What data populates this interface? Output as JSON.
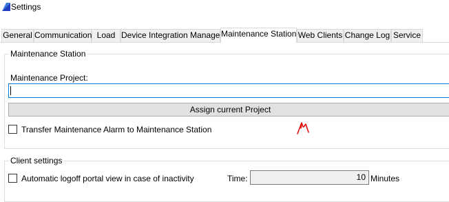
{
  "window": {
    "title": "Settings",
    "icon": "app-icon"
  },
  "tabs": [
    {
      "label": "General",
      "active": false
    },
    {
      "label": "Communication",
      "active": false
    },
    {
      "label": "Load",
      "active": false
    },
    {
      "label": "Device Integration Manager",
      "active": false
    },
    {
      "label": "Maintenance Station",
      "active": true
    },
    {
      "label": "Web Clients",
      "active": false
    },
    {
      "label": "Change Log",
      "active": false
    },
    {
      "label": "Service",
      "active": false
    }
  ],
  "maintenance": {
    "group_title": "Maintenance Station",
    "project_label": "Maintenance Project:",
    "project_value": "",
    "assign_button": "Assign current Project",
    "transfer_alarm_label": "Transfer Maintenance Alarm to Maintenance Station",
    "transfer_alarm_checked": false
  },
  "client": {
    "group_title": "Client settings",
    "auto_logoff_label": "Automatic logoff portal view in case of inactivity",
    "auto_logoff_checked": false,
    "time_label": "Time:",
    "time_value": "10",
    "time_unit": "Minutes"
  },
  "colors": {
    "focus_border": "#0078d7",
    "annotation": "#e00000"
  },
  "annotation": {
    "icon": "red-arrow-annotation"
  }
}
